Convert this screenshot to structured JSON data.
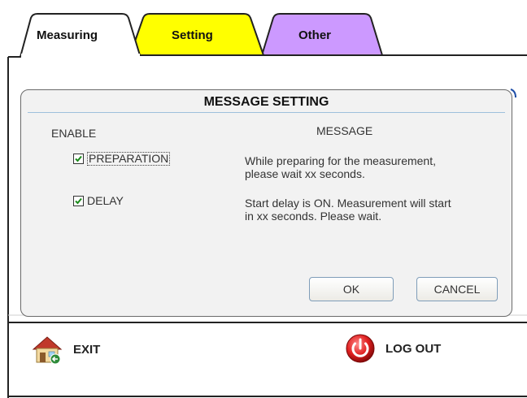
{
  "tabs": [
    {
      "label": "Measuring",
      "color": "#ffffff"
    },
    {
      "label": "Setting",
      "color": "#ffff00"
    },
    {
      "label": "Other",
      "color": "#cc99ff"
    }
  ],
  "dialog": {
    "title": "MESSAGE SETTING",
    "enable_header": "ENABLE",
    "message_header": "MESSAGE",
    "rows": [
      {
        "label": "PREPARATION",
        "checked": true,
        "message_line1": "While preparing for the measurement,",
        "message_line2": "please wait xx seconds."
      },
      {
        "label": "DELAY",
        "checked": true,
        "message_line1": "Start delay is ON. Measurement will start",
        "message_line2": "in xx seconds. Please wait."
      }
    ],
    "ok_label": "OK",
    "cancel_label": "CANCEL"
  },
  "footer": {
    "exit_label": "EXIT",
    "logout_label": "LOG OUT"
  },
  "icons": {
    "exit": "house-exit-icon",
    "logout": "power-icon"
  }
}
